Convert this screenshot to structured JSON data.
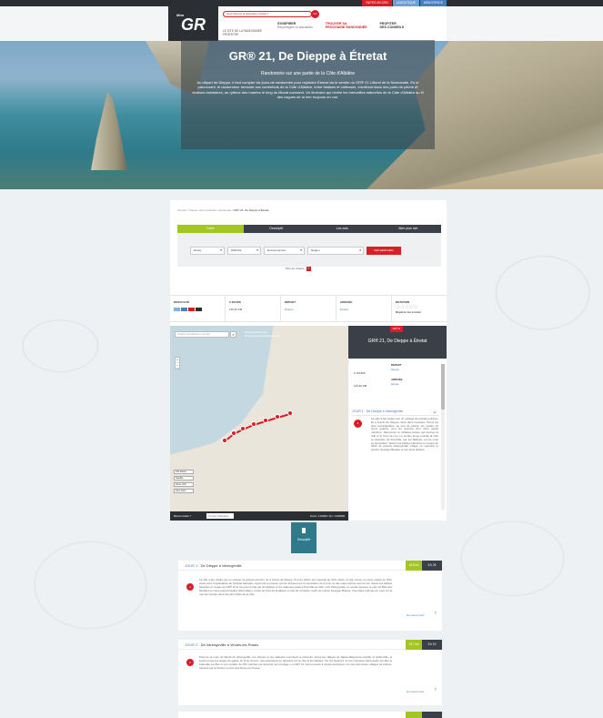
{
  "toplinks": [
    "FAITES UN DON",
    "LA BOUTIQUE",
    "MON ESPACE"
  ],
  "logo": {
    "small": "Mon",
    "big": "GR"
  },
  "search": {
    "placeholder": "Quel GR pour la destination choisie ?",
    "go": "GO"
  },
  "header_sub": "LE SITE DE LA RANDONNÉE PÉDESTRE",
  "nav": [
    {
      "title": "S'INSPIRER",
      "sub": "Reportages et actualités"
    },
    {
      "title": "TROUVER SA",
      "sub": "PROCHAINE RANDONNÉE"
    },
    {
      "title": "PROFITER",
      "sub": "DES CONSEILS"
    }
  ],
  "hero": {
    "title": "GR® 21, De Dieppe à Étretat",
    "subtitle": "Randonnée sur une partie de la Côte d'Albâtre",
    "text": "Au départ de Dieppe, il faut compter six jours de randonnée pour rejoindre Étretat via le sentier du GR® 21 Littoral de la Normandie. En le parcourant, le randonneur remonte aux contreforts de la Côte d'Albâtre, entre falaises et valleuses, s'arrêtant dans des ports de pêche et stations balnéaires, au rythme des marées le long du littoral normand. Un itinéraire qui révèle les merveilles naturelles de la Côte d'Albâtre au fil des vagues de la mer toujours en vue."
  },
  "breadcrumb": {
    "path": "Accueil / Trouver votre prochaine randonnée / ",
    "current": "GR® 21, De Dieppe à Étretat"
  },
  "tabs": [
    "Carte",
    "Descriptif",
    "Les avis",
    "Aller plus loin"
  ],
  "filters": {
    "duree": "Durée",
    "difficulte": "Difficulté",
    "environnement": "Environnement",
    "region": "Région",
    "submit": "RECHERCHER"
  },
  "more_criteria": "Plus de critères",
  "info": {
    "difficulty_label": "DIFFICULTÉ",
    "days_label": "6 JOURS",
    "days_value": "115,40 KM",
    "depart_label": "DÉPART",
    "depart_value": "Dieppe",
    "arrivee_label": "ARRIVÉE",
    "arrivee_value": "Étretat",
    "notation_label": "NOTATION",
    "stars": "☆☆☆☆☆",
    "rate_link": "Dépôt le 1er à noter"
  },
  "map": {
    "search_placeholder": "Trouver une adresse ou un lieu",
    "legend": [
      "Itinéraire",
      "Parcours",
      "Hébergements",
      "Restauration"
    ],
    "layers": [
      "IGN Raster",
      "Satellite",
      "Topo+ IGN",
      "Topo Scan"
    ],
    "bottom_left": "Besoin d'aide ?",
    "hint": "Trouver l'itinéraire",
    "scale": "Zoom: 1:10000 / km: 1:200000"
  },
  "side": {
    "badge": "GR® 21",
    "title": "GR® 21, De Dieppe à Étretat",
    "dist1": "6 JOURS",
    "dist2": "115,40 KM",
    "depart_label": "DÉPART",
    "depart_value": "Dieppe",
    "arrivee_label": "ARRIVÉE",
    "arrivee_value": "Étretat",
    "day_title": "JOUR 1 : De Dieppe à Varengeville",
    "day_num": "1",
    "day_text": "La ville a été visitée par un cortège de grands peintres, lié à l'école de Dieppe, situé dans l'estuaire. Parmi les plus remarquables, au port de pêche, les ruelles du vieux quartier sont les témoins d'un riche passé maritime. Découvrez le château-musée qui domine la ville et le front de mer. Le sentier longe ensuite la côte en direction de Pourville, par les falaises, où les vues se succèdent. Suivez les balises blanches et rouges du GR® 21 jusqu'à Varengeville, village où reposent le peintre Georges Braque et ses amis artistes."
  },
  "desc_tag": "Descriptif",
  "days": [
    {
      "prefix": "JOUR 1 :",
      "title": "De Dieppe à Varengeville",
      "km": "18,8 km",
      "hours": "5 h 25",
      "num": "1",
      "text": "La ville a été visitée par un cortège de grands peintres, lié à l'école de Dieppe. Port de pêche aux harengs au XIXe siècle, la cité connut un essor rapide au XIXe siècle avec l'implantation de l'activité balnéaire. Ayant été le premier port de France pour la importation de le bois, la ville reste tournée vers la mer. Suivez les balises blanches et rouges du GR® 21 le long de la côte par les falaises et les valleuses jusqu'à Pourville-sur-Mer, puis Varengeville. Le sentier traverse le parc du Bois des Moutiers et mène jusqu'à l'église Saint-Valery, posée au bord de la falaise, à côté du cimetière marin où repose Georges Braque. Une étape rythmée de vues sur la mer qui compte parmi les plus belles de la côte.",
      "more": "En savoir plus"
    },
    {
      "prefix": "JOUR 2 :",
      "title": "De Varengeville à Veules-les-Roses",
      "km": "19,7 km",
      "hours": "5 h 10",
      "num": "2",
      "text": "Prenons la route du littoral de Varengeville, les champs et les valleuses ponctuent le parcours. Après les villages de Sainte-Marguerite-sur-Mer et Quiberville, le sentier longe les plages de galets. Au fil du chemin, des panoramas se dévoilent sur la côte et les falaises. Sur les hauteurs, la vue embrasse Saint-Aubin-sur-Mer et Sotteville-sur-Mer et son escalier de 231 marches qui descend vers la plage. Le GR® 21 mène ensuite à Veules-les-Roses, l'un des plus beaux villages de France, traversé par la Veules, le plus petit fleuve de France.",
      "more": "En savoir plus"
    }
  ],
  "colors": {
    "accent_green": "#a3c720",
    "brand_red": "#d61f26",
    "dark": "#3b4048",
    "link_blue": "#4a7fbf"
  }
}
